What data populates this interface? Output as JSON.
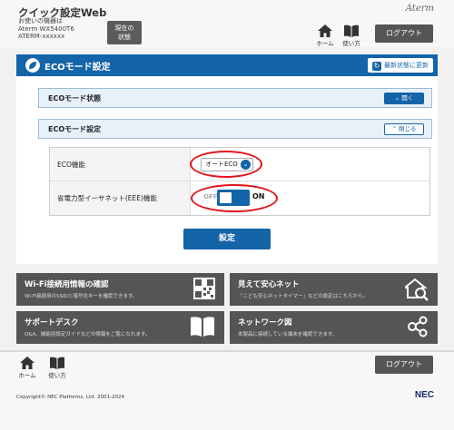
{
  "header": {
    "app_title": "クイック設定Web",
    "device_label": "お使いの機器は",
    "device_model": "Aterm WX5400T6",
    "device_ssid": "ATERM-xxxxxx",
    "status_button_line1": "現在の",
    "status_button_line2": "状態",
    "brand": "Aterm",
    "home_label": "ホーム",
    "help_label": "使い方",
    "logout_label": "ログアウト"
  },
  "panel": {
    "title": "ECOモード設定",
    "refresh_label": "最新状態に更新",
    "sections": [
      {
        "label": "ECOモード状態",
        "button": "開く"
      },
      {
        "label": "ECOモード設定",
        "button": "閉じる"
      }
    ],
    "rows": [
      {
        "label": "ECO機能",
        "value": "オートECO"
      },
      {
        "label": "省電力型イーサネット(EEE)機能",
        "off_label": "OFF",
        "on_label": "ON"
      }
    ],
    "submit_label": "設定"
  },
  "tiles": [
    {
      "title": "Wi-Fi接続用情報の確認",
      "desc": "Wi-Fi接続用のSSIDと暗号化キーを確認できます。",
      "icon": "qr-code-icon"
    },
    {
      "title": "見えて安心ネット",
      "desc": "「こども安心ネットタイマー」などの設定はこちらから。",
      "icon": "home-search-icon"
    },
    {
      "title": "サポートデスク",
      "desc": "Q&A、機能別設定ガイドなどの情報をご覧になれます。",
      "icon": "book-icon"
    },
    {
      "title": "ネットワーク図",
      "desc": "本製品に接続している端末を確認できます。",
      "icon": "network-icon"
    }
  ],
  "footer": {
    "home_label": "ホーム",
    "help_label": "使い方",
    "logout_label": "ログアウト",
    "copyright": "Copyright© NEC Platforms, Ltd. 2001-2024",
    "nec_logo": "NEC"
  },
  "colors": {
    "primary": "#1464a8",
    "highlight_ring": "#e0141c",
    "tile_bg": "#555555"
  }
}
